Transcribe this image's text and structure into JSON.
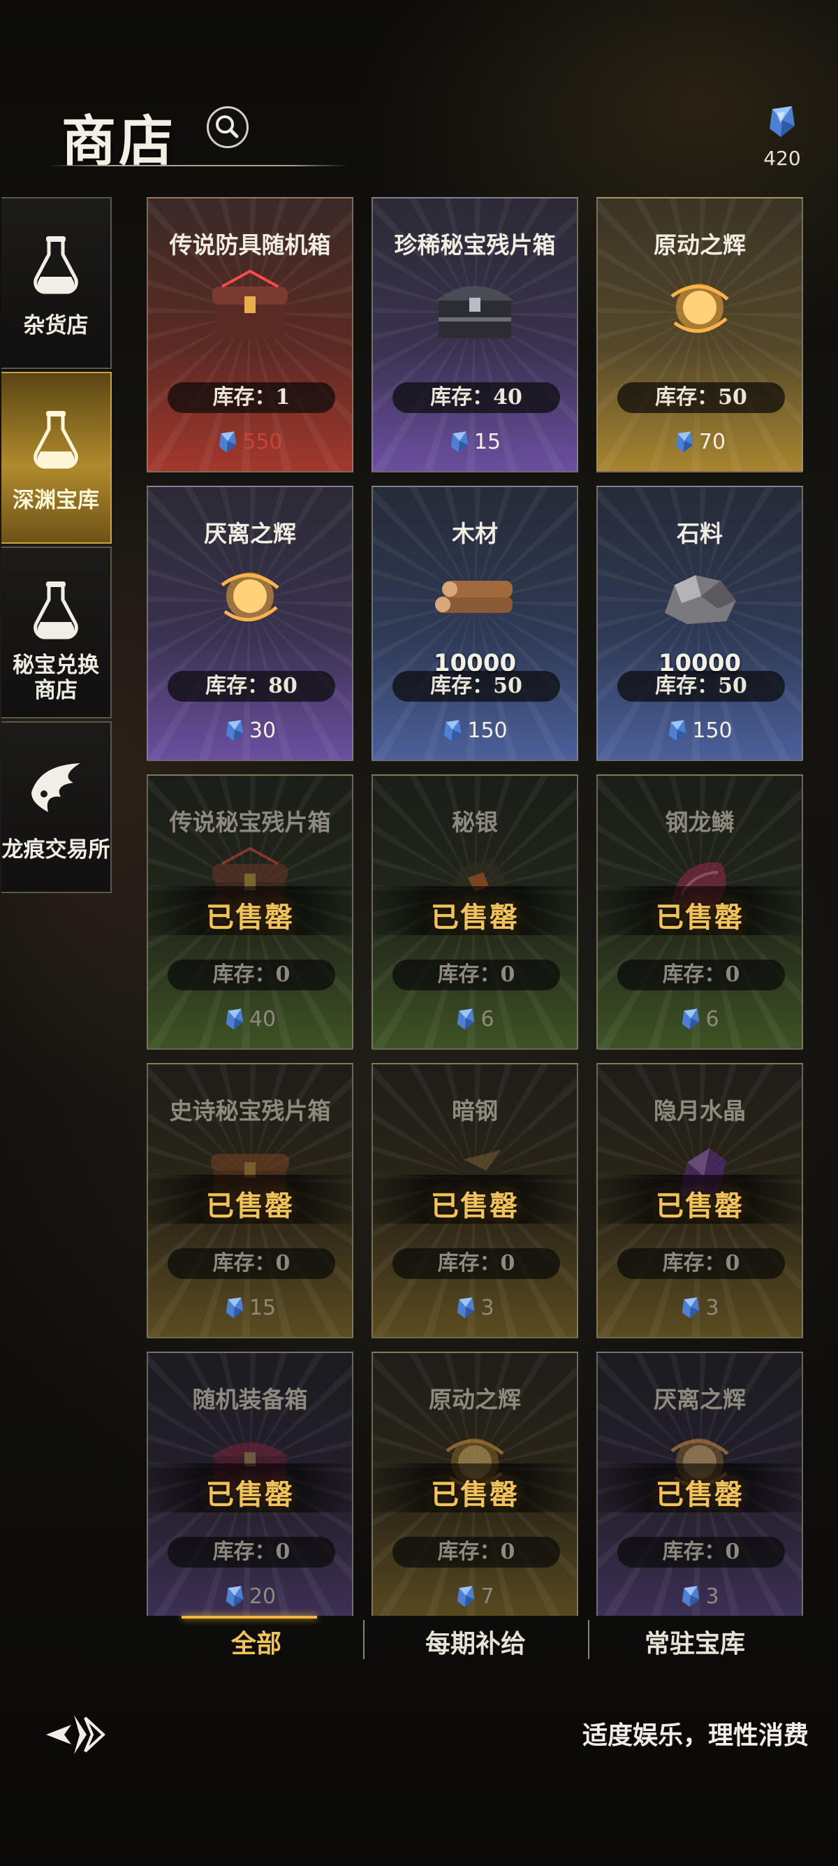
{
  "header": {
    "title": "商店",
    "currency_amount": "420"
  },
  "sidebar": {
    "tabs": [
      {
        "label": "杂货店",
        "active": false
      },
      {
        "label": "深渊宝库",
        "active": true
      },
      {
        "label": "秘宝兑换商店",
        "active": false
      },
      {
        "label": "龙痕交易所",
        "active": false
      }
    ]
  },
  "shop": {
    "sold_text": "已售罄",
    "items": [
      {
        "name": "传说防具随机箱",
        "stock": "库存：1",
        "price": "550",
        "price_state": "insufficient",
        "theme": "red",
        "icon": "legendary-chest-icon",
        "sold_out": false
      },
      {
        "name": "珍稀秘宝残片箱",
        "stock": "库存：40",
        "price": "15",
        "theme": "purple",
        "icon": "iron-chest-icon",
        "sold_out": false
      },
      {
        "name": "原动之辉",
        "stock": "库存：50",
        "price": "70",
        "theme": "gold",
        "icon": "golden-orb-icon",
        "sold_out": false
      },
      {
        "name": "厌离之辉",
        "stock": "库存：80",
        "price": "30",
        "theme": "purple",
        "icon": "golden-orb-icon",
        "sold_out": false
      },
      {
        "name": "木材",
        "quantity": "10000",
        "stock": "库存：50",
        "price": "150",
        "theme": "blue",
        "icon": "wood-logs-icon",
        "sold_out": false
      },
      {
        "name": "石料",
        "quantity": "10000",
        "stock": "库存：50",
        "price": "150",
        "theme": "blue",
        "icon": "stone-ore-icon",
        "sold_out": false
      },
      {
        "name": "传说秘宝残片箱",
        "stock": "库存：0",
        "price": "40",
        "theme": "green",
        "icon": "legendary-chest-icon",
        "sold_out": true
      },
      {
        "name": "秘银",
        "stock": "库存：0",
        "price": "6",
        "theme": "green",
        "icon": "mithril-ore-icon",
        "sold_out": true
      },
      {
        "name": "钢龙鳞",
        "stock": "库存：0",
        "price": "6",
        "theme": "green",
        "icon": "dragon-scale-icon",
        "sold_out": true
      },
      {
        "name": "史诗秘宝残片箱",
        "stock": "库存：0",
        "price": "15",
        "theme": "dgold",
        "icon": "wooden-chest-icon",
        "sold_out": true
      },
      {
        "name": "暗钢",
        "stock": "库存：0",
        "price": "3",
        "theme": "dgold",
        "icon": "dark-steel-icon",
        "sold_out": true
      },
      {
        "name": "隐月水晶",
        "stock": "库存：0",
        "price": "3",
        "theme": "dgold",
        "icon": "purple-crystal-icon",
        "sold_out": true
      },
      {
        "name": "随机装备箱",
        "stock": "库存：0",
        "price": "20",
        "theme": "dpurple",
        "icon": "red-chest-icon",
        "sold_out": true
      },
      {
        "name": "原动之辉",
        "stock": "库存：0",
        "price": "7",
        "theme": "dgold",
        "icon": "golden-orb-icon",
        "sold_out": true
      },
      {
        "name": "厌离之辉",
        "stock": "库存：0",
        "price": "3",
        "theme": "dpurple",
        "icon": "golden-orb-icon",
        "sold_out": true
      }
    ]
  },
  "bottom_tabs": [
    {
      "label": "全部",
      "active": true
    },
    {
      "label": "每期补给",
      "active": false
    },
    {
      "label": "常驻宝库",
      "active": false
    }
  ],
  "footer": {
    "slogan": "适度娱乐，理性消费"
  },
  "colors": {
    "accent_gold": "#f2b93b",
    "sold_text": "#f2c35b",
    "insufficient_price": "#c9443a",
    "gem_blue": "#6fa8e8"
  }
}
